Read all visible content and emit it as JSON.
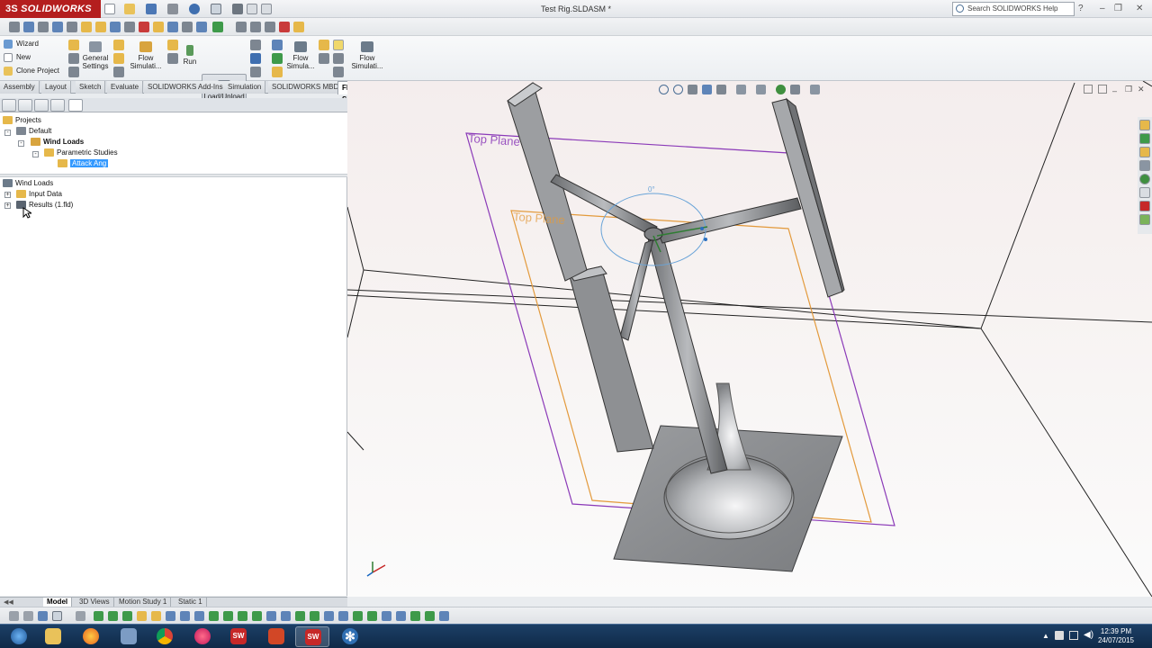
{
  "app": {
    "logo_text": "SOLIDWORKS",
    "logo_prefix": "3S"
  },
  "window": {
    "title": "Test Rig.SLDASM *",
    "help_search_placeholder": "Search SOLIDWORKS Help"
  },
  "ribbon": {
    "wizard": "Wizard",
    "new": "New",
    "clone_project": "Clone Project",
    "general_settings": "General Settings",
    "flow_simulation_1": "Flow Simulati...",
    "run": "Run",
    "load_unload": "Load/Unload",
    "flow_simulation_2": "Flow Simula...",
    "flow_simulation_3": "Flow Simulati..."
  },
  "command_tabs": [
    {
      "label": "Assembly",
      "active": false
    },
    {
      "label": "Layout",
      "active": false
    },
    {
      "label": "Sketch",
      "active": false
    },
    {
      "label": "Evaluate",
      "active": false
    },
    {
      "label": "SOLIDWORKS Add-Ins",
      "active": false
    },
    {
      "label": "Simulation",
      "active": false
    },
    {
      "label": "SOLIDWORKS MBD",
      "active": false
    },
    {
      "label": "Flow Simulation",
      "active": true
    }
  ],
  "projects_tree": {
    "root": "Projects",
    "default": "Default",
    "wind_loads": "Wind Loads",
    "parametric_studies": "Parametric Studies",
    "attack_ang": "Attack Ang"
  },
  "analysis_tree": {
    "root": "Wind Loads",
    "input_data": "Input Data",
    "results": "Results (1.fld)"
  },
  "viewport": {
    "plane1_label": "Top Plane",
    "plane2_label": "Top Plane",
    "angle_label": "0°"
  },
  "bottom_tabs": [
    {
      "label": "Model",
      "active": true
    },
    {
      "label": "3D Views",
      "active": false
    },
    {
      "label": "Motion Study 1",
      "active": false
    },
    {
      "label": "Static 1",
      "active": false
    }
  ],
  "clock": {
    "time": "12:39 PM",
    "date": "24/07/2015"
  },
  "taskbar_apps": [
    "windows-start",
    "file-explorer",
    "firefox",
    "file-manager",
    "chrome",
    "itunes",
    "solidworks-2015",
    "powerpoint",
    "solidworks-2015-active",
    "snowflake-app"
  ],
  "colors": {
    "brand_red": "#b41e1e",
    "plane_purple": "#8b3ab8",
    "plane_orange": "#e39a3c",
    "selection_blue": "#3399ff",
    "taskbar": "#1c3f66"
  }
}
